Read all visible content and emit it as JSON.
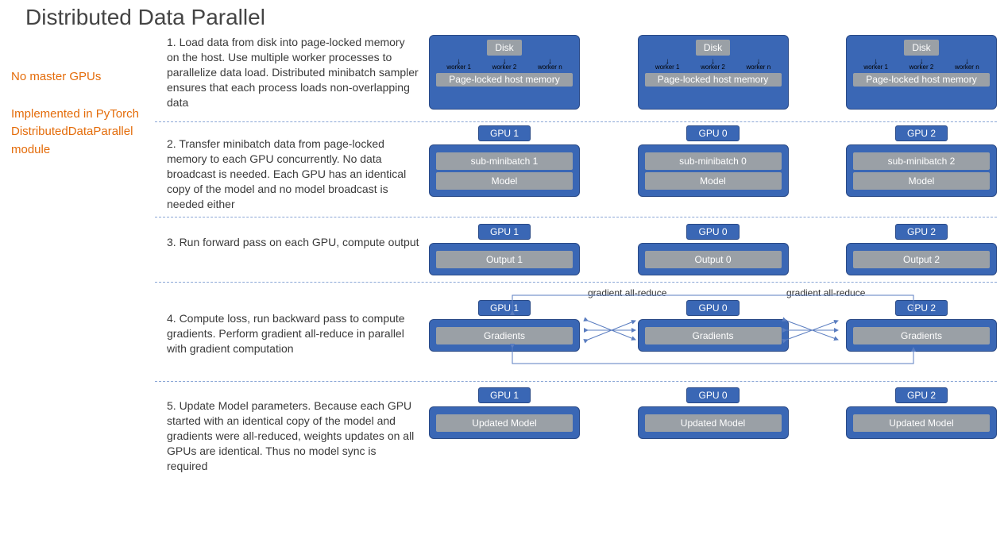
{
  "title": "Distributed Data Parallel",
  "sidebar": {
    "note1": "No master GPUs",
    "note2": "Implemented in PyTorch DistributedDataParallel module"
  },
  "steps": {
    "s1": "1. Load data from disk into page-locked memory on the host. Use multiple worker processes to parallelize data load. Distributed minibatch sampler ensures that each process loads non-overlapping data",
    "s2": "2. Transfer minibatch data from page-locked memory  to each GPU concurrently. No data broadcast is needed. Each GPU has an identical copy of the model and no model broadcast is needed either",
    "s3": "3. Run forward pass on each GPU, compute output",
    "s4": "4. Compute loss, run backward pass to compute gradients. Perform gradient all-reduce in parallel with gradient computation",
    "s5": "5. Update Model parameters. Because each GPU started with an identical copy of the model and gradients were all-reduced, weights updates on all GPUs are identical. Thus no model sync is required"
  },
  "labels": {
    "disk": "Disk",
    "pagelocked": "Page-locked host memory",
    "worker1": "worker 1",
    "worker2": "worker 2",
    "workern": "worker n",
    "gpu0": "GPU 0",
    "gpu1": "GPU 1",
    "gpu2": "GPU 2",
    "submb0": "sub-minibatch 0",
    "submb1": "sub-minibatch 1",
    "submb2": "sub-minibatch 2",
    "model": "Model",
    "output0": "Output 0",
    "output1": "Output 1",
    "output2": "Output 2",
    "gradients": "Gradients",
    "updated": "Updated Model",
    "allreduce": "gradient all-reduce"
  }
}
